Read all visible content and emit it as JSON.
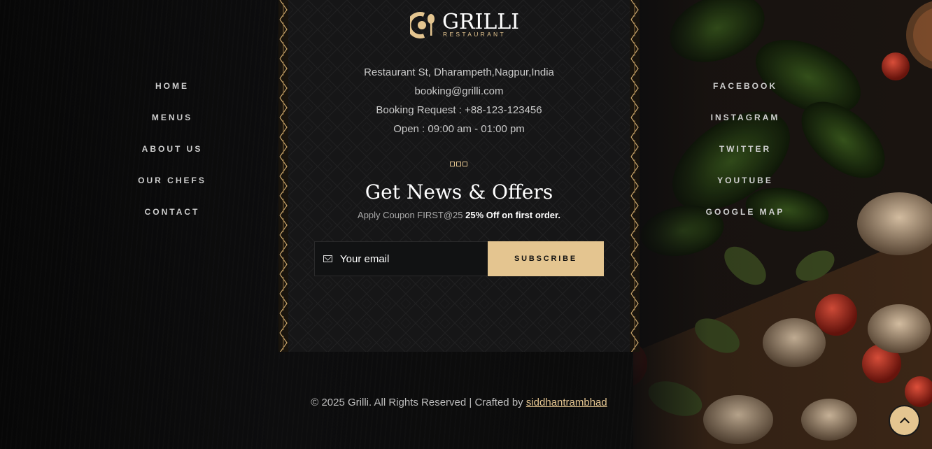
{
  "brand": {
    "name": "GRILLI",
    "tagline": "RESTAURANT"
  },
  "contact": {
    "address": "Restaurant St, Dharampeth,Nagpur,India",
    "email": "booking@grilli.com",
    "booking": "Booking Request : +88-123-123456",
    "hours": "Open : 09:00 am - 01:00 pm"
  },
  "newsletter": {
    "title": "Get News & Offers",
    "coupon_text": "Apply Coupon FIRST@25",
    "coupon_offer": "25% Off on first order.",
    "email_placeholder": "Your email",
    "subscribe_label": "SUBSCRIBE"
  },
  "nav_left": [
    "HOME",
    "MENUS",
    "ABOUT US",
    "OUR CHEFS",
    "CONTACT"
  ],
  "nav_right": [
    "FACEBOOK",
    "INSTAGRAM",
    "TWITTER",
    "YOUTUBE",
    "GOOGLE MAP"
  ],
  "footer": {
    "copyright": "© 2025 Grilli. All Rights Reserved | Crafted by",
    "author_link": "siddhantrambhad"
  },
  "colors": {
    "accent": "#e4c590",
    "panel": "#161617",
    "background": "#0c0c0d"
  },
  "icons": {
    "mail": "mail-icon",
    "back_to_top": "chevron-up-icon",
    "logo": "cup-spoon-icon"
  }
}
